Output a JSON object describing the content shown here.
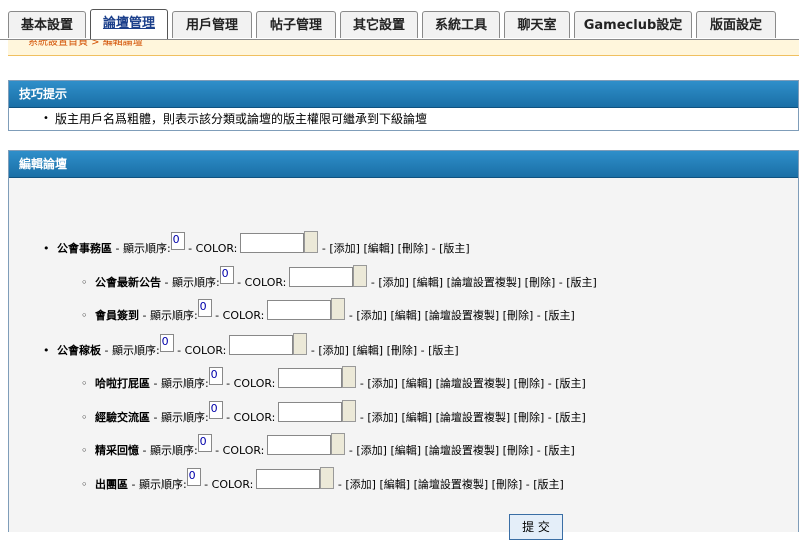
{
  "tabs": [
    "基本設置",
    "論壇管理",
    "用戶管理",
    "帖子管理",
    "其它設置",
    "系統工具",
    "聊天室",
    "Gameclub設定",
    "版面設定"
  ],
  "active_tab": "論壇管理",
  "breadcrumb": "系統設置首頁 > 編輯論壇",
  "tips": {
    "title": "技巧提示",
    "text": "版主用戶名爲粗體，則表示該分類或論壇的版主權限可繼承到下級論壇"
  },
  "edit": {
    "title": "編輯論壇",
    "order_label": "- 顯示順序:",
    "color_label": "- COLOR:",
    "sep": "-",
    "links": {
      "add": "[添加]",
      "edit": "[編輯]",
      "copy": "[論壇設置複製]",
      "delete": "[刪除]",
      "mod": "[版主]"
    },
    "forums": [
      {
        "name": "公會事務區",
        "order": "0",
        "level": 0
      },
      {
        "name": "公會最新公告",
        "order": "0",
        "level": 1
      },
      {
        "name": "會員簽到",
        "order": "0",
        "level": 1
      },
      {
        "name": "公會稼板",
        "order": "0",
        "level": 0
      },
      {
        "name": "哈啦打屁區",
        "order": "0",
        "level": 1
      },
      {
        "name": "經驗交流區",
        "order": "0",
        "level": 1
      },
      {
        "name": "精采回憶",
        "order": "0",
        "level": 1
      },
      {
        "name": "出團區",
        "order": "0",
        "level": 1
      }
    ],
    "submit_label": "提 交"
  }
}
